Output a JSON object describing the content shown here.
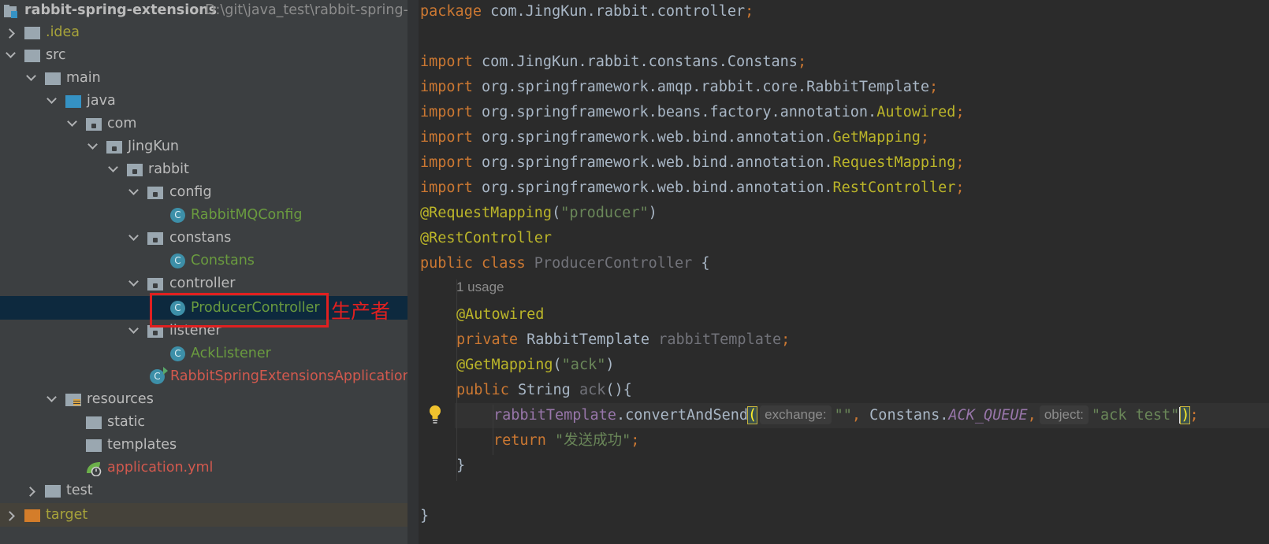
{
  "project_tree": {
    "root": {
      "name": "rabbit-spring-extensions",
      "path": "D:\\git\\java_test\\rabbit-spring-e"
    },
    "items": [
      {
        "label": ".idea"
      },
      {
        "label": "src"
      },
      {
        "label": "main"
      },
      {
        "label": "java"
      },
      {
        "label": "com"
      },
      {
        "label": "JingKun"
      },
      {
        "label": "rabbit"
      },
      {
        "label": "config"
      },
      {
        "label": "RabbitMQConfig"
      },
      {
        "label": "constans"
      },
      {
        "label": "Constans"
      },
      {
        "label": "controller"
      },
      {
        "label": "ProducerController"
      },
      {
        "label": "listener"
      },
      {
        "label": "AckListener"
      },
      {
        "label": "RabbitSpringExtensionsApplication"
      },
      {
        "label": "resources"
      },
      {
        "label": "static"
      },
      {
        "label": "templates"
      },
      {
        "label": "application.yml"
      },
      {
        "label": "test"
      },
      {
        "label": "target"
      }
    ],
    "class_icon_letter": "C",
    "annotation": "生产者"
  },
  "editor": {
    "l1": {
      "kw": "package",
      "rest": " com.JingKun.rabbit.controller",
      "semi": ";"
    },
    "imports": [
      {
        "kw": "import",
        "pkg": " com.JingKun.rabbit.constans.Constans",
        "cls": "",
        "semi": ";"
      },
      {
        "kw": "import",
        "pkg": " org.springframework.amqp.rabbit.core.RabbitTemplate",
        "cls": "",
        "semi": ";"
      },
      {
        "kw": "import",
        "pkg": " org.springframework.beans.factory.annotation.",
        "cls": "Autowired",
        "semi": ";"
      },
      {
        "kw": "import",
        "pkg": " org.springframework.web.bind.annotation.",
        "cls": "GetMapping",
        "semi": ";"
      },
      {
        "kw": "import",
        "pkg": " org.springframework.web.bind.annotation.",
        "cls": "RequestMapping",
        "semi": ";"
      },
      {
        "kw": "import",
        "pkg": " org.springframework.web.bind.annotation.",
        "cls": "RestController",
        "semi": ";"
      }
    ],
    "request_mapping": {
      "ann": "@RequestMapping",
      "open": "(",
      "value": "\"producer\"",
      "close": ")"
    },
    "rest_controller": "@RestController",
    "class_decl": {
      "kw": "public class",
      "name": " ProducerController",
      "brace": " {"
    },
    "usage_hint": "1 usage",
    "autowired": "@Autowired",
    "field": {
      "kw": "private",
      "type": " RabbitTemplate ",
      "name": "rabbitTemplate",
      "semi": ";"
    },
    "get_mapping": {
      "ann": "@GetMapping",
      "open": "(",
      "value": "\"ack\"",
      "close": ")"
    },
    "method": {
      "kw": "public",
      "sig": " String ",
      "name": "ack",
      "rest": "(){"
    },
    "call": {
      "obj": "rabbitTemplate",
      "dot": ".",
      "method": "convertAndSend",
      "open": "(",
      "hint1": "exchange:",
      "arg1": "\"\"",
      "comma1": ",",
      "cls": " Constans.",
      "const": "ACK_QUEUE",
      "comma2": ",",
      "hint2": "object:",
      "arg2": "\"ack test\"",
      "close": ")",
      "semi": ";"
    },
    "ret": {
      "kw": "return",
      "str": " \"发送成功\"",
      "semi": ";"
    },
    "method_close": "}",
    "class_close": "}"
  }
}
